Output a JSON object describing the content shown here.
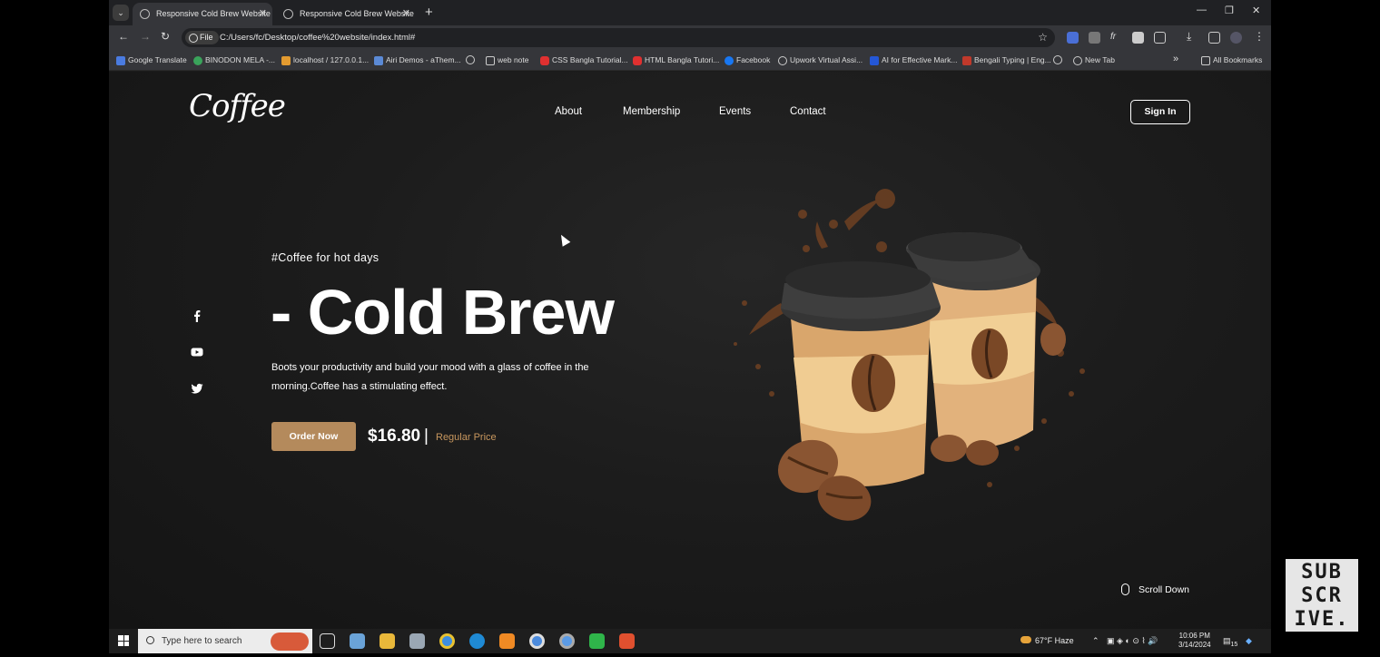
{
  "browser": {
    "tabs": [
      {
        "title": "Responsive Cold Brew Website",
        "active": true
      },
      {
        "title": "Responsive Cold Brew Website",
        "active": false
      }
    ],
    "address": {
      "chip": "File",
      "url": "C:/Users/fc/Desktop/coffee%20website/index.html#"
    },
    "bookmarks": [
      "Google Translate",
      "BINODON MELA -...",
      "localhost / 127.0.0.1...",
      "Airi Demos - aThem...",
      "web note",
      "CSS Bangla Tutorial...",
      "HTML Bangla Tutori...",
      "Facebook",
      "Upwork Virtual Assi...",
      "AI for Effective Mark...",
      "Bengali Typing | Eng...",
      "New Tab"
    ],
    "all_bookmarks": "All Bookmarks"
  },
  "site": {
    "logo": "Coffee",
    "nav": [
      "About",
      "Membership",
      "Events",
      "Contact"
    ],
    "sign_in": "Sign In",
    "hashtag": "#Coffee for hot days",
    "title": "- Cold Brew",
    "description": "Boots your productivity and build your mood with a glass of coffee in the morning.Coffee has a stimulating effect.",
    "order_button": "Order Now",
    "price": "$16.80",
    "price_separator": "|",
    "price_label": "Regular Price",
    "scroll_down": "Scroll Down",
    "social_icons": [
      "facebook-icon",
      "youtube-icon",
      "twitter-icon"
    ],
    "colors": {
      "accent": "#b48a5c",
      "price_label": "#c8975e",
      "background": "#1b1b1b"
    }
  },
  "taskbar": {
    "search_placeholder": "Type here to search",
    "weather": "67°F  Haze",
    "time": "10:06 PM",
    "date": "3/14/2024",
    "notifications": "15"
  },
  "watermark": {
    "lines": [
      "SUB",
      "SCR",
      "IVE."
    ]
  }
}
